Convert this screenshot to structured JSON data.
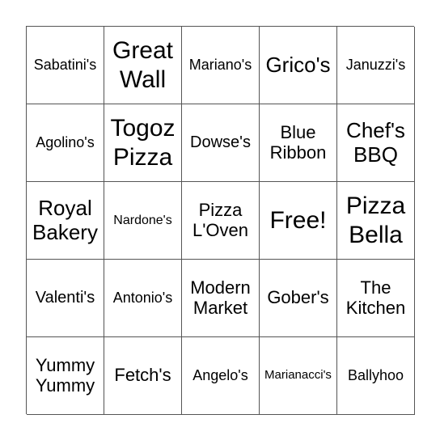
{
  "board": {
    "cells": [
      [
        "Sabatini's",
        "Great\nWall",
        "Mariano's",
        "Grico's",
        "Januzzi's"
      ],
      [
        "Agolino's",
        "Togoz\nPizza",
        "Dowse's",
        "Blue\nRibbon",
        "Chef's\nBBQ"
      ],
      [
        "Royal\nBakery",
        "Nardone's",
        "Pizza\nL'Oven",
        "Free!",
        "Pizza\nBella"
      ],
      [
        "Valenti's",
        "Antonio's",
        "Modern\nMarket",
        "Gober's",
        "The\nKitchen"
      ],
      [
        "Yummy\nYummy",
        "Fetch's",
        "Angelo's",
        "Marianacci's",
        "Ballyhoo"
      ]
    ]
  }
}
